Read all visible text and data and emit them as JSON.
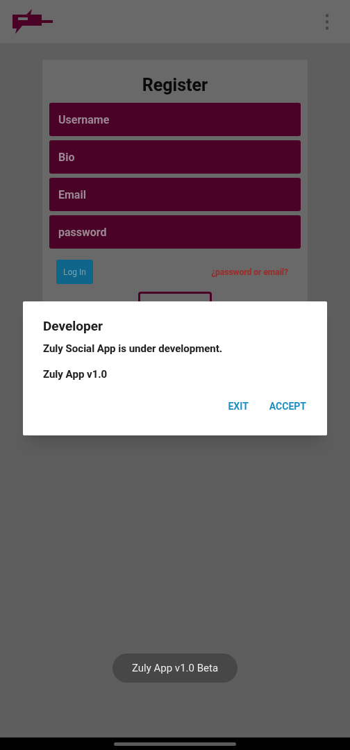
{
  "app_bar": {
    "menu": "⋮"
  },
  "register_form": {
    "title": "Register",
    "fields": [
      {
        "placeholder": "Username"
      },
      {
        "placeholder": "Bio"
      },
      {
        "placeholder": "Email"
      },
      {
        "placeholder": "password"
      }
    ],
    "login_button": "Log In",
    "forgot_link": "¿password or email?"
  },
  "dialog": {
    "title": "Developer",
    "message": "Zuly Social App is under development.",
    "version": "Zuly App v1.0",
    "buttons": [
      "EXIT",
      "ACCEPT"
    ]
  },
  "toast": "Zuly App v1.0 Beta"
}
